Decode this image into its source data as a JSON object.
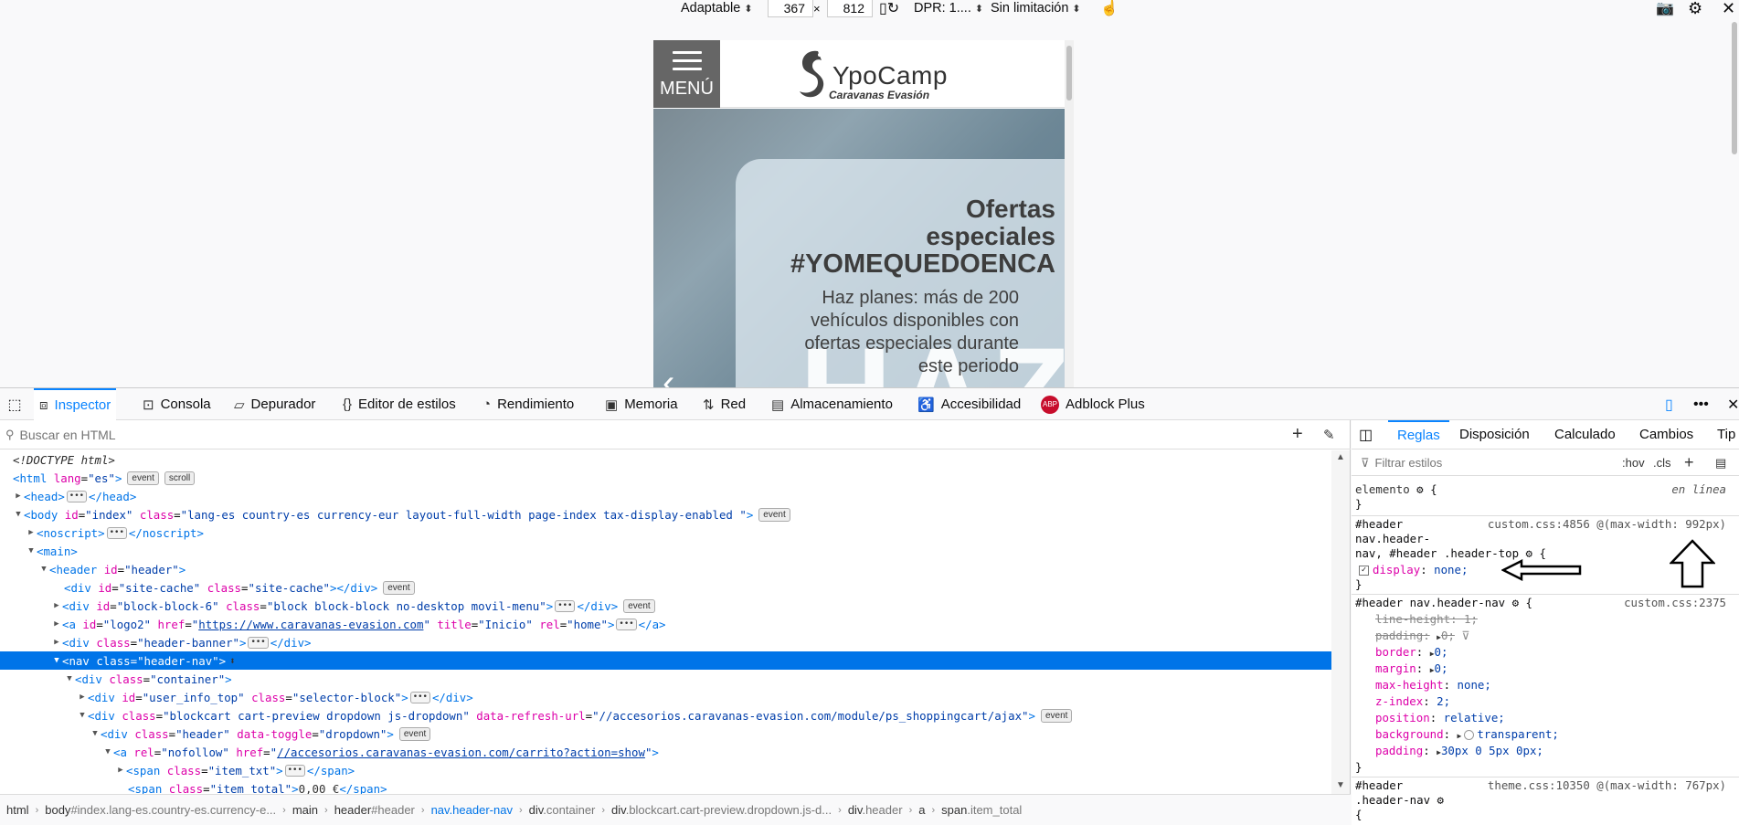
{
  "rdm": {
    "device": "Adaptable",
    "width": "367",
    "times": "×",
    "height": "812",
    "dpr": "DPR: 1....",
    "throttle": "Sin limitación"
  },
  "mobile": {
    "menu_label": "MENÚ",
    "logo_name": "YpoCamp",
    "logo_sub": "Caravanas Evasión",
    "hero_line1": "Ofertas",
    "hero_line2": "especiales",
    "hero_line3": "#YOMEQUEDOENCA",
    "hero_body": "Haz planes: más de 200 vehículos disponibles con ofertas especiales durante este periodo",
    "hero_big": "HAZ"
  },
  "toolbar": {
    "tabs": [
      {
        "label": "Inspector"
      },
      {
        "label": "Consola"
      },
      {
        "label": "Depurador"
      },
      {
        "label": "Editor de estilos"
      },
      {
        "label": "Rendimiento"
      },
      {
        "label": "Memoria"
      },
      {
        "label": "Red"
      },
      {
        "label": "Almacenamiento"
      },
      {
        "label": "Accesibilidad"
      },
      {
        "label": "Adblock Plus"
      }
    ]
  },
  "search": {
    "placeholder": "Buscar en HTML"
  },
  "tree": {
    "doctype": "<!DOCTYPE html>",
    "html_open": "html",
    "html_lang_attr": "lang",
    "html_lang_val": "\"es\"",
    "badge_event": "event",
    "badge_scroll": "scroll",
    "head": "head",
    "body_id_attr": "id",
    "body_id_val": "\"index\"",
    "body_class_attr": "class",
    "body_class_val": "\"lang-es country-es currency-eur layout-full-width page-index tax-display-enabled \"",
    "noscript": "noscript",
    "main": "main",
    "header_id_val": "\"header\"",
    "site_cache_id": "\"site-cache\"",
    "site_cache_class": "\"site-cache\"",
    "block6_id": "\"block-block-6\"",
    "block6_class": "\"block block-block no-desktop movil-menu\"",
    "logo2_id": "\"logo2\"",
    "logo2_href": "https://www.caravanas-evasion.com",
    "logo2_title": "\"Inicio\"",
    "logo2_rel": "\"home\"",
    "banner_class": "\"header-banner\"",
    "nav_class": "\"header-nav\"",
    "container_class": "\"container\"",
    "userinfo_id": "\"user_info_top\"",
    "userinfo_class": "\"selector-block\"",
    "cart_class": "\"blockcart cart-preview dropdown js-dropdown\"",
    "cart_refresh_attr": "data-refresh-url",
    "cart_refresh_val": "\"//accesorios.caravanas-evasion.com/module/ps_shoppingcart/ajax\"",
    "hdr_class": "\"header\"",
    "hdr_toggle_attr": "data-toggle",
    "hdr_toggle_val": "\"dropdown\"",
    "a_rel_val": "\"nofollow\"",
    "a_href_val": "//accesorios.caravanas-evasion.com/carrito?action=show",
    "item_txt_class": "\"item_txt\"",
    "item_total_class": "\"item_total\"",
    "item_total_text": "0,00 €"
  },
  "rules_tabs": [
    "Reglas",
    "Disposición",
    "Calculado",
    "Cambios",
    "Tip"
  ],
  "filter": {
    "placeholder": "Filtrar estilos",
    "hov": ":hov",
    "cls": ".cls"
  },
  "rules": {
    "elemento": "elemento",
    "en_linea": "en línea",
    "r1_sel_a": "#header",
    "r1_sel_b": "nav.header-",
    "r1_sel_c": "nav, #header .header-top",
    "r1_src": "custom.css:4856 @(max-width: 992px)",
    "r1_prop": "display",
    "r1_val": "none;",
    "r2_sel": "#header nav.header-nav",
    "r2_src": "custom.css:2375",
    "props": [
      {
        "name": "line-height",
        "val": "1;"
      },
      {
        "name": "padding",
        "val": "0;"
      },
      {
        "name": "border",
        "val": "0;"
      },
      {
        "name": "margin",
        "val": "0;"
      },
      {
        "name": "max-height",
        "val": "none;"
      },
      {
        "name": "z-index",
        "val": "2;"
      },
      {
        "name": "position",
        "val": "relative;"
      },
      {
        "name": "background",
        "val": "transparent;"
      },
      {
        "name": "padding",
        "val": "30px 0 5px 0px;"
      }
    ],
    "r3_sel_a": "#header",
    "r3_sel_b": ".header-nav",
    "r3_src": "theme.css:10350 @(max-width: 767px)"
  },
  "crumbs": [
    {
      "tag": "html",
      "rest": ""
    },
    {
      "tag": "body",
      "rest": "#index.lang-es.country-es.currency-e..."
    },
    {
      "tag": "main",
      "rest": ""
    },
    {
      "tag": "header",
      "rest": "#header"
    },
    {
      "tag": "nav",
      "rest": ".header-nav"
    },
    {
      "tag": "div",
      "rest": ".container"
    },
    {
      "tag": "div",
      "rest": ".blockcart.cart-preview.dropdown.js-d..."
    },
    {
      "tag": "div",
      "rest": ".header"
    },
    {
      "tag": "a",
      "rest": ""
    },
    {
      "tag": "span",
      "rest": ".item_total"
    }
  ]
}
